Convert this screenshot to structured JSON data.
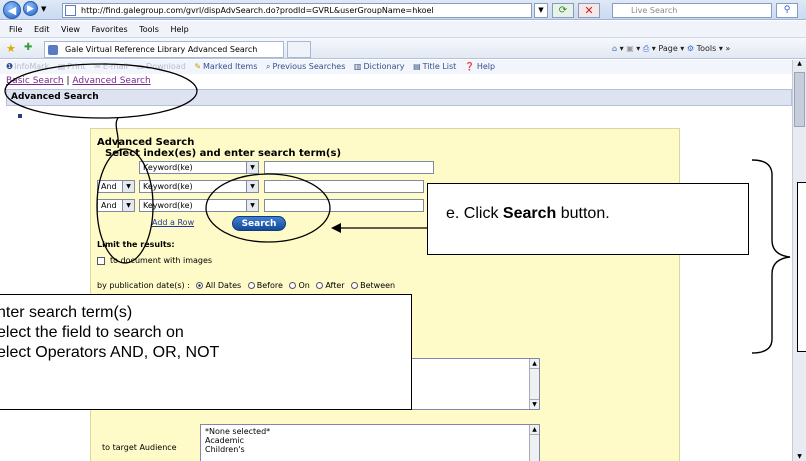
{
  "browser": {
    "url": "http://find.galegroup.com/gvrl/dispAdvSearch.do?prodId=GVRL&userGroupName=hkoel",
    "search_placeholder": "Live Search",
    "menu": [
      "File",
      "Edit",
      "View",
      "Favorites",
      "Tools",
      "Help"
    ],
    "tab_title": "Gale Virtual Reference Library Advanced Search",
    "toolbar_right": [
      "Page",
      "Tools"
    ]
  },
  "site_toolbar": {
    "items": [
      "InfoMark",
      "Print",
      "E-mail",
      "Download",
      "Marked Items",
      "Previous Searches",
      "Dictionary",
      "Title List",
      "Help"
    ]
  },
  "nav": {
    "basic_search": "Basic Search",
    "separator": "|",
    "advanced_search": "Advanced Search"
  },
  "page_title": "Advanced Search",
  "form": {
    "title": "Advanced Search",
    "subtitle": "Select index(es) and enter search term(s)",
    "rows": [
      {
        "operator": "",
        "index": "Keyword(ke)",
        "term": ""
      },
      {
        "operator": "And",
        "index": "Keyword(ke)",
        "term": ""
      },
      {
        "operator": "And",
        "index": "Keyword(ke)",
        "term": ""
      }
    ],
    "add_row": "Add a Row",
    "search_button": "Search",
    "limit_title": "Limit the results:",
    "images_checkbox": "to document with images",
    "pub_date_label": "by publication date(s) :",
    "pub_date_options": [
      "All Dates",
      "Before",
      "On",
      "After",
      "Between"
    ],
    "pub_date_selected": "All Dates",
    "audience_label": "to target Audience",
    "audience_options": [
      "*None selected*",
      "Academic",
      "Children's"
    ]
  },
  "callouts": {
    "e": {
      "prefix": "e. Click ",
      "bold": "Search",
      "suffix": " button."
    },
    "left_lines": [
      "nter search term(s)",
      "elect the field to search on",
      "elect Operators AND, OR, NOT"
    ]
  }
}
